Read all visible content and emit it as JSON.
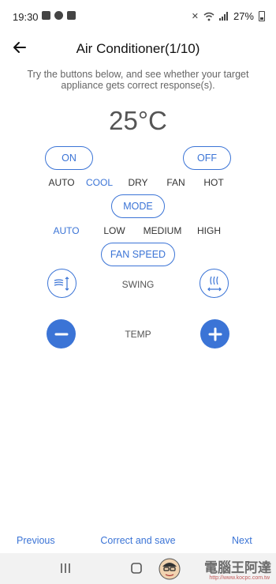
{
  "status": {
    "time": "19:30",
    "battery_text": "27%"
  },
  "header": {
    "title": "Air Conditioner(1/10)"
  },
  "instructions": "Try the buttons below, and see whether your target appliance gets correct response(s).",
  "temperature": "25°C",
  "power": {
    "on_label": "ON",
    "off_label": "OFF"
  },
  "modes": {
    "options": [
      "AUTO",
      "COOL",
      "DRY",
      "FAN",
      "HOT"
    ],
    "active": "COOL",
    "button_label": "MODE"
  },
  "fan_speed": {
    "options": [
      "AUTO",
      "LOW",
      "MEDIUM",
      "HIGH"
    ],
    "active": "AUTO",
    "button_label": "FAN SPEED"
  },
  "swing": {
    "label": "SWING"
  },
  "temp_control": {
    "label": "TEMP"
  },
  "footer": {
    "previous": "Previous",
    "correct_save": "Correct and save",
    "next": "Next"
  },
  "watermark": {
    "text": "電腦王阿達",
    "url": "http://www.kocpc.com.tw"
  },
  "colors": {
    "accent": "#3b74d6",
    "text": "#333333",
    "muted": "#666666"
  }
}
